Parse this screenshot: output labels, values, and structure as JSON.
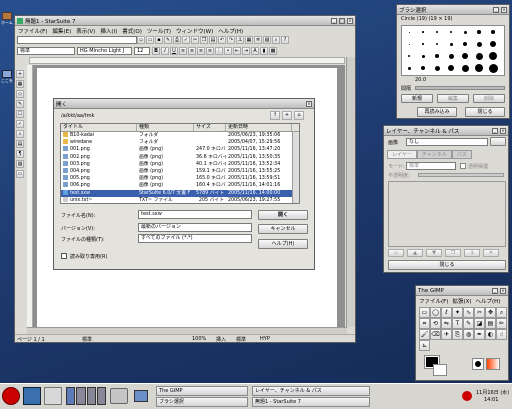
{
  "desktop": {
    "icons": [
      {
        "label": "ホーム"
      },
      {
        "label": "ここを"
      }
    ]
  },
  "writer": {
    "title": "無題1 - StarSuite 7",
    "menu": [
      "ファイル(F)",
      "編集(E)",
      "表示(V)",
      "挿入(I)",
      "書式(O)",
      "ツール(T)",
      "ウィンドウ(W)",
      "ヘルプ(H)"
    ],
    "style_value": "標準",
    "font_value": "HG Mincho Light J",
    "size_value": "12",
    "status": {
      "page": "ページ 1 / 1",
      "style": "標準",
      "zoom": "100%",
      "mode": "挿入",
      "std": "標準",
      "hyp": "HYP"
    }
  },
  "open_dialog": {
    "title": "開く",
    "path": "/a/kkt/aa/tmk",
    "columns": [
      "タイトル",
      "種類",
      "サイズ",
      "更新日時"
    ],
    "files": [
      {
        "name": "B10-kadai",
        "type": "フォルダ",
        "size": "",
        "date": "2005/06/23, 19:35:06",
        "icon": "folder"
      },
      {
        "name": "wiredane",
        "type": "フォルダ",
        "size": "",
        "date": "2005/04/07, 15:29:56",
        "icon": "folder"
      },
      {
        "name": "001.png",
        "type": "画像 (png)",
        "size": "247.0 キロバイト",
        "date": "2005/11/16, 13:47:20",
        "icon": "image"
      },
      {
        "name": "002.png",
        "type": "画像 (png)",
        "size": "36.6 キロバイト",
        "date": "2005/11/16, 13:50:35",
        "icon": "image"
      },
      {
        "name": "003.png",
        "type": "画像 (png)",
        "size": "40.1 キロバイト",
        "date": "2005/11/16, 13:52:34",
        "icon": "image"
      },
      {
        "name": "004.png",
        "type": "画像 (png)",
        "size": "159.1 キロバイト",
        "date": "2005/11/16, 13:55:25",
        "icon": "image"
      },
      {
        "name": "005.png",
        "type": "画像 (png)",
        "size": "165.0 キロバイト",
        "date": "2005/11/16, 13:59:51",
        "icon": "image"
      },
      {
        "name": "006.png",
        "type": "画像 (png)",
        "size": "160.4 キロバイト",
        "date": "2005/11/16, 14:01:16",
        "icon": "image"
      },
      {
        "name": "test.sxw",
        "type": "StarSuite 6.0/7 文書 F",
        "size": "5789 バイト",
        "date": "2005/11/16, 14:00:00",
        "icon": "doc",
        "selected": true
      },
      {
        "name": "unix.txt~",
        "type": "TXT~ ファイル",
        "size": "205 バイト",
        "date": "2005/06/23, 19:27:55",
        "icon": "file"
      }
    ],
    "filename_label": "ファイル名(N):",
    "filename_value": "test.sxw",
    "version_label": "バージョン(V):",
    "version_value": "最新のバージョン",
    "filetype_label": "ファイルの種類(T):",
    "filetype_value": "すべてのファイル (*.*)",
    "readonly_label": "読み取り専用(R)",
    "open_btn": "開く",
    "cancel_btn": "キャンセル",
    "help_btn": "ヘルプ(H)"
  },
  "brush_window": {
    "title": "ブラシ選択",
    "brush_name": "Circle (19)  (19 × 19)",
    "spacing_value": "20.0",
    "spacing_label": "間隔",
    "buttons": [
      "新規",
      "編集",
      "削除"
    ],
    "refresh_btn": "再読み込み",
    "close_btn": "閉じる"
  },
  "layers_window": {
    "title": "レイヤー、チャンネル & パス",
    "image_label": "画像",
    "image_value": "なし",
    "tabs": [
      "レイヤー",
      "チャンネル",
      "パス"
    ],
    "mode_label": "モード:",
    "mode_value": "標準",
    "keep_trans": "透明保護",
    "opacity_label": "不透明度:",
    "close_btn": "閉じる"
  },
  "gimp_window": {
    "title": "The GIMP",
    "menu": [
      "ファイル(F)",
      "拡張(X)",
      "ヘルプ(H)"
    ]
  },
  "taskbar": {
    "tasks": [
      {
        "label": "The GIMP"
      },
      {
        "label": "ブラシ選択"
      },
      {
        "label": "レイヤー、チャンネル & パス"
      },
      {
        "label": "無題1 - StarSuite 7"
      }
    ],
    "date": "11月16日 (水)",
    "time": "14:01"
  },
  "colors": {
    "selection": "#3a5fad",
    "desktop": "#1c3668",
    "redhat": "#cc0000"
  }
}
